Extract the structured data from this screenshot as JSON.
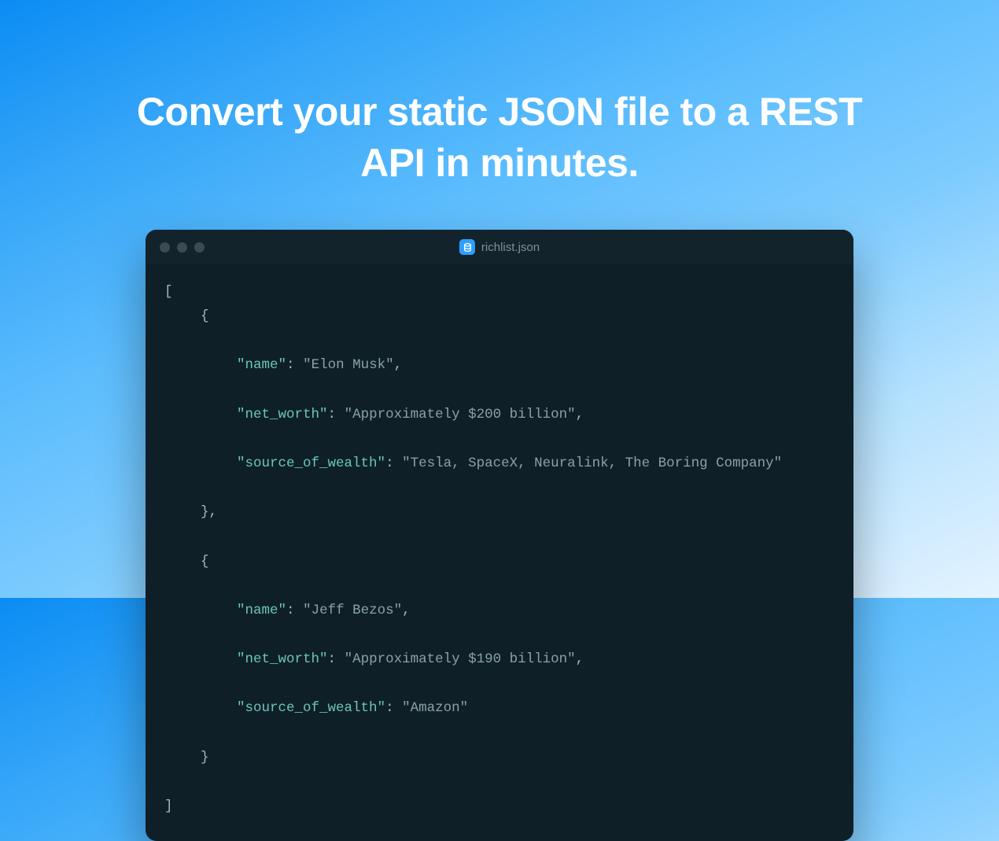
{
  "headline": "Convert your static JSON file to a REST API in minutes.",
  "editor": {
    "filename": "richlist.json",
    "records": [
      {
        "name": "Elon Musk",
        "net_worth": "Approximately $200 billion",
        "source_of_wealth": "Tesla, SpaceX, Neuralink, The Boring Company"
      },
      {
        "name": "Jeff Bezos",
        "net_worth": "Approximately $190 billion",
        "source_of_wealth": "Amazon"
      }
    ]
  },
  "tokens": {
    "open_bracket": "[",
    "close_bracket": "]",
    "open_brace": "{",
    "close_brace_comma": "},",
    "close_brace": "}",
    "q": "\"",
    "colon_sp": ": ",
    "comma_after": ",",
    "k_name": "name",
    "k_net_worth": "net_worth",
    "k_source": "source_of_wealth"
  }
}
